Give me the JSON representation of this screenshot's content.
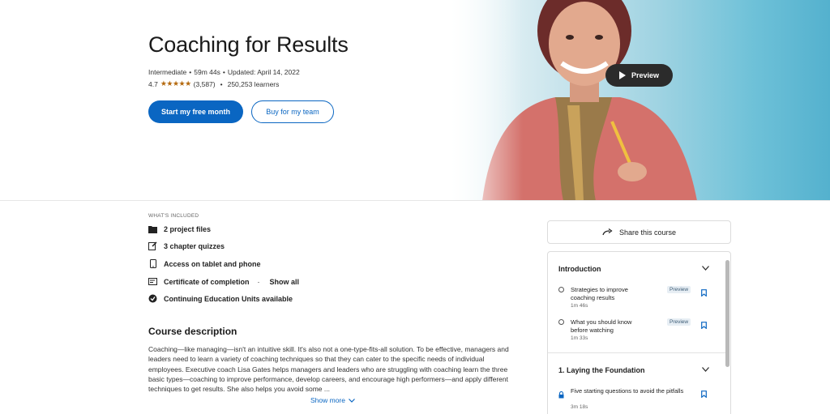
{
  "course": {
    "title": "Coaching for Results",
    "level": "Intermediate",
    "duration": "59m 44s",
    "updated": "Updated: April 14, 2022",
    "rating": "4.7",
    "stars": "★★★★★",
    "reviews": "(3,587)",
    "learners": "250,253 learners"
  },
  "buttons": {
    "start": "Start my free month",
    "team": "Buy for my team",
    "preview": "Preview"
  },
  "included": {
    "label": "WHAT'S INCLUDED",
    "items": [
      {
        "icon": "folder-icon",
        "label": "2 project files"
      },
      {
        "icon": "edit-icon",
        "label": "3 chapter quizzes"
      },
      {
        "icon": "phone-icon",
        "label": "Access on tablet and phone"
      },
      {
        "icon": "certificate-icon",
        "label": "Certificate of completion"
      },
      {
        "icon": "badge-icon",
        "label": "Continuing Education Units available"
      }
    ],
    "show_all": "Show all"
  },
  "description": {
    "heading": "Course description",
    "text": "Coaching—like managing—isn't an intuitive skill. It's also not a one-type-fits-all solution. To be effective, managers and leaders need to learn a variety of coaching techniques so that they can cater to the specific needs of individual employees. Executive coach Lisa Gates helps managers and leaders who are struggling with coaching learn the three basic types—coaching to improve performance, develop careers, and encourage high performers—and apply different techniques to get results. She also helps you avoid some ...",
    "show_more": "Show more"
  },
  "share": {
    "label": "Share this course"
  },
  "toc": {
    "sections": [
      {
        "title": "Introduction",
        "lessons": [
          {
            "title": "Strategies to improve coaching results",
            "duration": "1m 46s",
            "badge": "Preview"
          },
          {
            "title": "What you should know before watching",
            "duration": "1m 33s",
            "badge": "Preview"
          }
        ]
      },
      {
        "title": "1. Laying the Foundation",
        "lessons": [
          {
            "title": "Five starting questions to avoid the pitfalls",
            "duration": "3m 18s",
            "badge": ""
          }
        ]
      }
    ]
  },
  "colors": {
    "accent": "#0a66c2",
    "star": "#b4690e",
    "preview_button": "#2b2b2b"
  }
}
